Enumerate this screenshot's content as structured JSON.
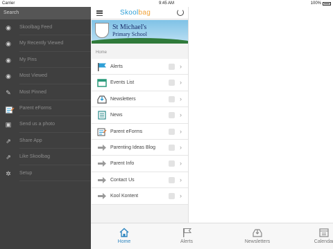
{
  "status": {
    "carrier": "Carrier",
    "time": "9:45 AM",
    "battery": "100%"
  },
  "drawer": {
    "search_label": "Search",
    "items": [
      {
        "label": "Skoolbag Feed",
        "icon": "rss-icon"
      },
      {
        "label": "My Recently Viewed",
        "icon": "eye-icon"
      },
      {
        "label": "My Pins",
        "icon": "eye-icon"
      },
      {
        "label": "Most Viewed",
        "icon": "eye-icon"
      },
      {
        "label": "Most Pinned",
        "icon": "pin-icon"
      },
      {
        "label": "Parent eForms",
        "icon": "form-icon"
      },
      {
        "label": "Send us a photo",
        "icon": "camera-icon"
      },
      {
        "label": "Share App",
        "icon": "share-icon"
      },
      {
        "label": "Like Skoolbag",
        "icon": "like-icon"
      },
      {
        "label": "Setup",
        "icon": "gear-icon"
      }
    ]
  },
  "header": {
    "logo_main": "Skool",
    "logo_accent": "bag"
  },
  "banner": {
    "line1": "St Michael's",
    "line2": "Primary School"
  },
  "section_label": "Home",
  "menu": [
    {
      "label": "Alerts",
      "icon": "flag-icon"
    },
    {
      "label": "Events List",
      "icon": "calendar-icon"
    },
    {
      "label": "Newsletters",
      "icon": "inbox-icon"
    },
    {
      "label": "News",
      "icon": "document-icon"
    },
    {
      "label": "Parent eForms",
      "icon": "form-icon"
    },
    {
      "label": "Parenting Ideas Blog",
      "icon": "arrow-right-icon"
    },
    {
      "label": "Parent Info",
      "icon": "arrow-right-icon"
    },
    {
      "label": "Contact Us",
      "icon": "arrow-right-icon"
    },
    {
      "label": "Kool Kontent",
      "icon": "arrow-right-icon"
    }
  ],
  "tabs": [
    {
      "label": "Home",
      "icon": "home-icon",
      "active": true
    },
    {
      "label": "Alerts",
      "icon": "flag-icon"
    },
    {
      "label": "Newsletters",
      "icon": "inbox-icon"
    },
    {
      "label": "Calendar",
      "icon": "calendar-icon"
    }
  ],
  "colors": {
    "accent": "#2e86c1",
    "drawer_bg": "#3f3f3f",
    "logo_blue": "#2e9fd6",
    "logo_orange": "#f0a23a"
  }
}
